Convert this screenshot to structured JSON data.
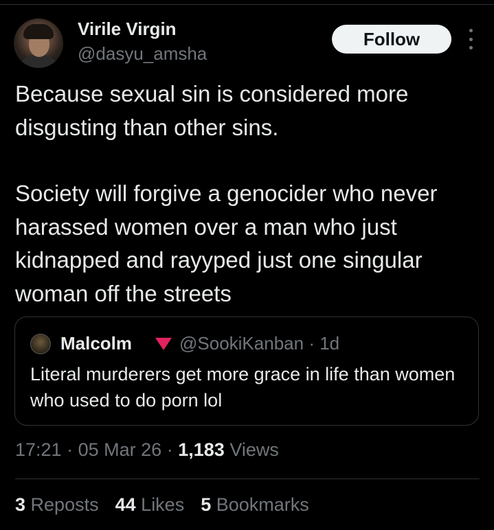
{
  "author": {
    "display_name": "Virile Virgin",
    "handle": "@dasyu_amsha",
    "avatar_icon": "profile-photo"
  },
  "follow_label": "Follow",
  "tweet": {
    "paragraphs": [
      "Because sexual sin is considered more disgusting than other sins.",
      "Society will forgive a genocider who never harassed women over a man who just kidnapped and rayyped just one singular woman off the streets"
    ]
  },
  "quote": {
    "author_name": "Malcolm",
    "handle": "@SookiKanban",
    "age": "1d",
    "separator": "·",
    "text": "Literal murderers get more grace in life than women who used to do porn lol",
    "flag_color": "#e0245e"
  },
  "meta": {
    "time": "17:21",
    "date": "05 Mar 26",
    "separator": "·",
    "views_count": "1,183",
    "views_label": "Views"
  },
  "stats": {
    "reposts_count": "3",
    "reposts_label": "Reposts",
    "likes_count": "44",
    "likes_label": "Likes",
    "bookmarks_count": "5",
    "bookmarks_label": "Bookmarks"
  }
}
